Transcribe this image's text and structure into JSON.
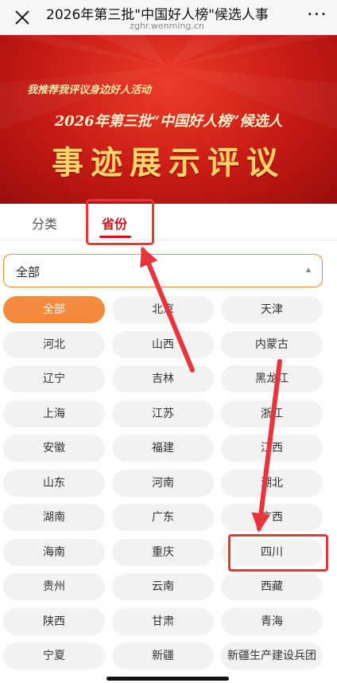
{
  "topbar": {
    "title": "2026年第三批\"中国好人榜\"候选人事",
    "subtitle": "zghr.wenming.cn",
    "more_label": "···"
  },
  "banner": {
    "line1": "我推荐我评议身边好人活动",
    "line2": "2026年第三批“中国好人榜”候选人",
    "line3": "事迹展示评议"
  },
  "tabs": [
    {
      "label": "分类"
    },
    {
      "label": "省份"
    }
  ],
  "select": {
    "value": "全部",
    "arrow": "▲"
  },
  "provinces": [
    "全部",
    "北京",
    "天津",
    "河北",
    "山西",
    "内蒙古",
    "辽宁",
    "吉林",
    "黑龙江",
    "上海",
    "江苏",
    "浙江",
    "安徽",
    "福建",
    "江西",
    "山东",
    "河南",
    "湖北",
    "湖南",
    "广东",
    "广西",
    "海南",
    "重庆",
    "四川",
    "贵州",
    "云南",
    "西藏",
    "陕西",
    "甘肃",
    "青海",
    "宁夏",
    "新疆",
    "新疆生产建设兵团"
  ],
  "selected_province": "全部",
  "colors": {
    "accent_orange": "#f48a3c",
    "brand_red": "#c8161d",
    "annotation_red": "#e8343a"
  }
}
